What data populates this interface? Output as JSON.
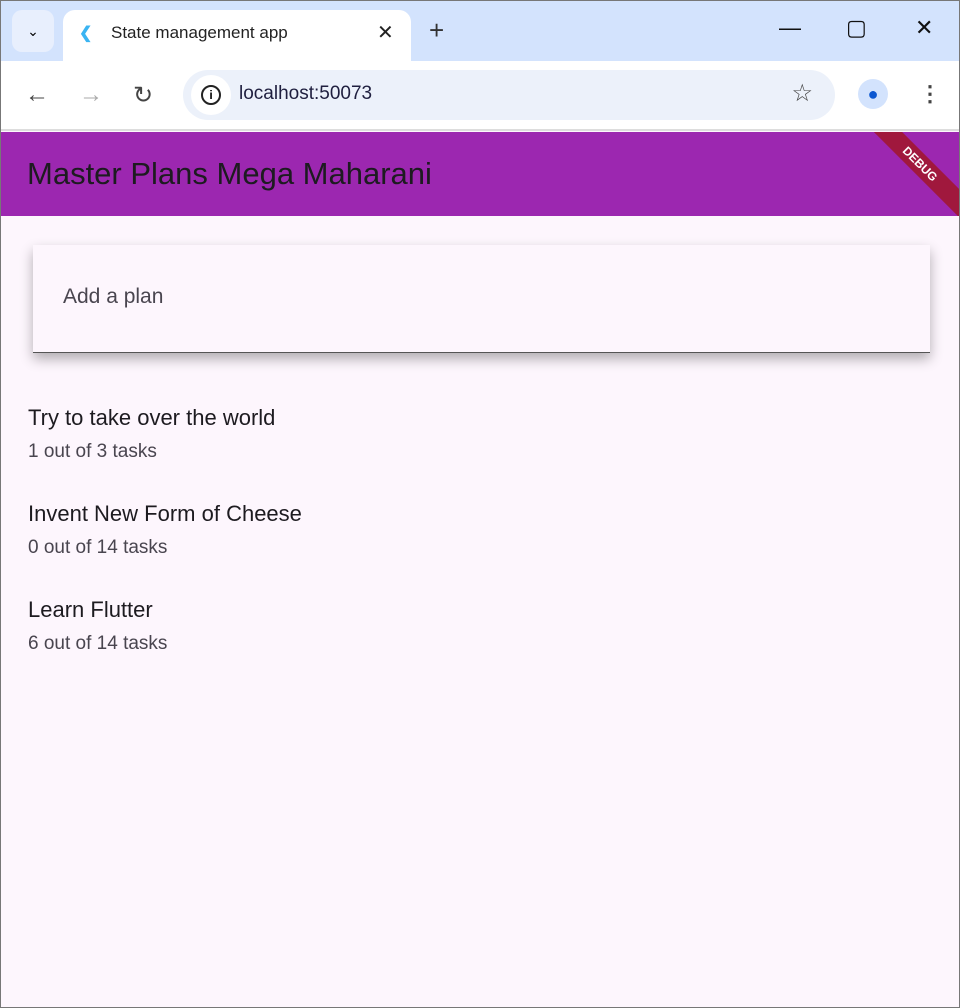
{
  "browser": {
    "tab_title": "State management app",
    "url": "localhost:50073"
  },
  "app": {
    "title": "Master Plans Mega Maharani",
    "debug_label": "DEBUG",
    "input_placeholder": "Add a plan",
    "plans": [
      {
        "name": "Try to take over the world",
        "progress": "1 out of 3 tasks"
      },
      {
        "name": "Invent New Form of Cheese",
        "progress": "0 out of 14 tasks"
      },
      {
        "name": "Learn Flutter",
        "progress": "6 out of 14 tasks"
      }
    ]
  }
}
